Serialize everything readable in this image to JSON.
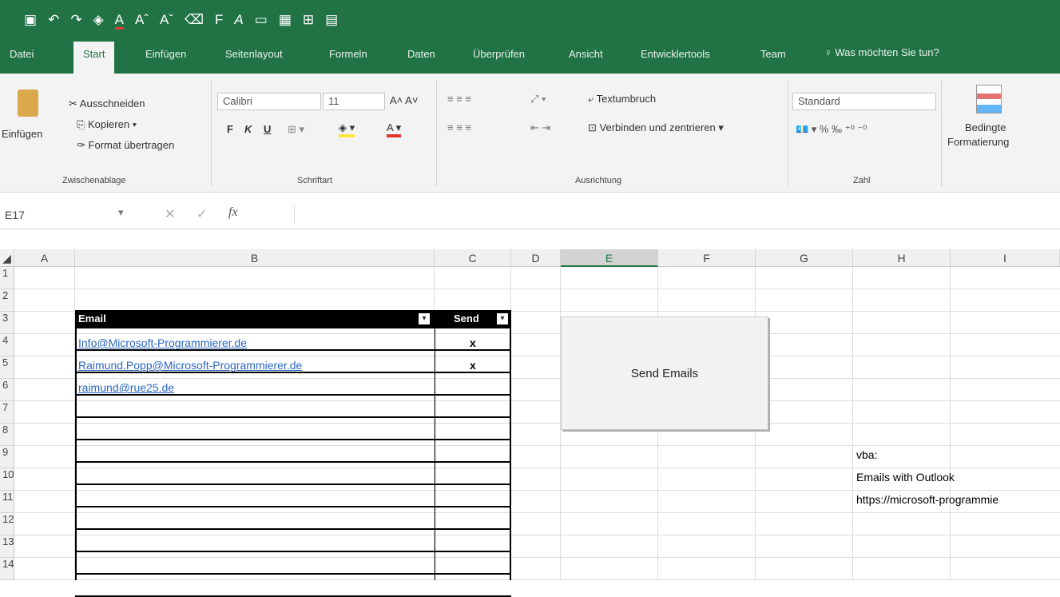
{
  "colors": {
    "brand": "#217346",
    "link": "#2b66c1"
  },
  "qat": {
    "icons": [
      "save-icon",
      "undo-icon",
      "redo-icon",
      "fill-color-icon",
      "font-color-icon",
      "increase-font-icon",
      "decrease-font-icon",
      "clear-format-icon",
      "bold-icon",
      "italic-icon",
      "new-file-icon",
      "table-icon",
      "border-icon",
      "more-icon"
    ]
  },
  "tabs": {
    "items": [
      "Datei",
      "Start",
      "Einfügen",
      "Seitenlayout",
      "Formeln",
      "Daten",
      "Überprüfen",
      "Ansicht",
      "Entwicklertools",
      "Team"
    ],
    "tell_me": "Was möchten Sie tun?"
  },
  "ribbon": {
    "clipboard": {
      "paste": "Einfügen",
      "cut": "Ausschneiden",
      "copy": "Kopieren",
      "format_painter": "Format übertragen",
      "group": "Zwischenablage"
    },
    "font": {
      "name": "Calibri",
      "size": "11",
      "bold": "F",
      "italic": "K",
      "underline": "U",
      "group": "Schriftart"
    },
    "alignment": {
      "wrap": "Textumbruch",
      "merge": "Verbinden und zentrieren",
      "group": "Ausrichtung"
    },
    "number": {
      "format": "Standard",
      "group": "Zahl"
    },
    "styles": {
      "conditional": "Bedingte",
      "conditional2": "Formatierung"
    }
  },
  "formula_bar": {
    "name_box": "E17",
    "fx": "fx",
    "value": ""
  },
  "sheet": {
    "columns": [
      "A",
      "B",
      "C",
      "D",
      "E",
      "F",
      "G",
      "H",
      "I"
    ],
    "rows": [
      "1",
      "2",
      "3",
      "4",
      "5",
      "6",
      "7",
      "8",
      "9",
      "10",
      "11",
      "12",
      "13",
      "14"
    ],
    "table_headers": {
      "email": "Email",
      "send": "Send"
    },
    "emails": [
      "Info@Microsoft-Programmierer.de",
      "Raimund.Popp@Microsoft-Programmierer.de",
      "raimund@rue25.de"
    ],
    "send_marks": [
      "x",
      "x",
      ""
    ],
    "notes": [
      "vba:",
      "Emails with Outlook",
      "https://microsoft-programmie"
    ]
  },
  "button": {
    "label": "Send Emails"
  }
}
